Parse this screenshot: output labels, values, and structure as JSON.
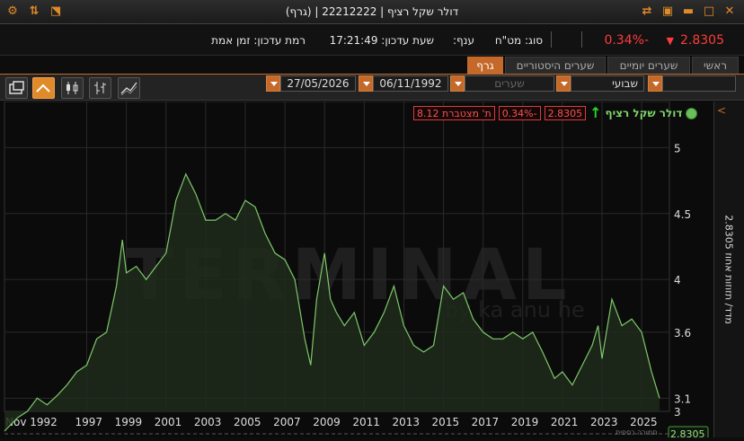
{
  "window": {
    "title": "דולר שקל רציף | 22212222 | (גרף)"
  },
  "info": {
    "price": "2.8305",
    "change": "-0.34%",
    "type": "סוג: מט\"ח",
    "branch": "ענף:",
    "update_time": "שעת עדכון: 17:21:49",
    "update_level": "רמת עדכון: זמן אמת"
  },
  "tabs": [
    {
      "label": "ראשי"
    },
    {
      "label": "שערים יומיים"
    },
    {
      "label": "שערים היסטוריים"
    },
    {
      "label": "גרף"
    }
  ],
  "toolbar": {
    "period": "שבועי",
    "rates_placeholder": "שערים",
    "date_from": "06/11/1992",
    "date_to": "27/05/2026"
  },
  "legend": {
    "name": "דולר שקל רציף",
    "price": "2.8305",
    "change": "-0.34%",
    "cumulative": "ת' מצטברת 8.12"
  },
  "y_axis_label": "מדד/ תזוזות אחוז 2.8305",
  "watermark": "TERMINAL",
  "watermark_sub": "by ka    anu    he",
  "last_price_tag": "2.8305",
  "footer_note": "תמורה כספית",
  "colors": {
    "line": "#7ec86a",
    "fill": "#1e2b1c",
    "accent": "#c4692a",
    "negative": "#ff3b3b"
  },
  "chart_data": {
    "type": "area",
    "title": "",
    "xlabel": "",
    "ylabel": "מדד/ תזוזות אחוז 2.8305",
    "ylim": [
      3,
      5.2
    ],
    "yticks": [
      3,
      3.1,
      3.6,
      4,
      4.5,
      5
    ],
    "xticks": [
      "Nov 1992",
      "1997",
      "1999",
      "2001",
      "2003",
      "2005",
      "2007",
      "2009",
      "2011",
      "2013",
      "2015",
      "2017",
      "2019",
      "2021",
      "2023",
      "2025"
    ],
    "grid": true,
    "series": [
      {
        "name": "דולר שקל רציף",
        "x": [
          1992.85,
          1993.5,
          1994.0,
          1994.5,
          1995.0,
          1995.5,
          1996.0,
          1996.5,
          1997.0,
          1997.5,
          1998.0,
          1998.5,
          1998.8,
          1999.0,
          1999.5,
          2000.0,
          2000.5,
          2001.0,
          2001.5,
          2002.0,
          2002.5,
          2003.0,
          2003.5,
          2004.0,
          2004.5,
          2005.0,
          2005.5,
          2006.0,
          2006.5,
          2007.0,
          2007.5,
          2008.0,
          2008.3,
          2008.6,
          2009.0,
          2009.3,
          2009.6,
          2010.0,
          2010.5,
          2011.0,
          2011.5,
          2012.0,
          2012.5,
          2013.0,
          2013.5,
          2014.0,
          2014.5,
          2015.0,
          2015.5,
          2016.0,
          2016.5,
          2017.0,
          2017.5,
          2018.0,
          2018.5,
          2019.0,
          2019.5,
          2020.0,
          2020.3,
          2020.6,
          2021.0,
          2021.5,
          2022.0,
          2022.5,
          2022.8,
          2023.0,
          2023.5,
          2024.0,
          2024.5,
          2025.0,
          2025.5,
          2025.9
        ],
        "values": [
          2.85,
          2.95,
          3.0,
          3.1,
          3.05,
          3.12,
          3.2,
          3.3,
          3.35,
          3.55,
          3.6,
          3.95,
          4.3,
          4.05,
          4.1,
          4.0,
          4.1,
          4.2,
          4.6,
          4.8,
          4.65,
          4.45,
          4.45,
          4.5,
          4.45,
          4.6,
          4.55,
          4.35,
          4.2,
          4.15,
          4.0,
          3.55,
          3.35,
          3.85,
          4.2,
          3.85,
          3.75,
          3.65,
          3.75,
          3.5,
          3.6,
          3.75,
          3.95,
          3.65,
          3.5,
          3.45,
          3.5,
          3.95,
          3.85,
          3.9,
          3.7,
          3.6,
          3.55,
          3.55,
          3.6,
          3.55,
          3.6,
          3.45,
          3.35,
          3.25,
          3.3,
          3.2,
          3.35,
          3.5,
          3.65,
          3.4,
          3.85,
          3.65,
          3.7,
          3.6,
          3.3,
          3.1
        ]
      }
    ]
  }
}
